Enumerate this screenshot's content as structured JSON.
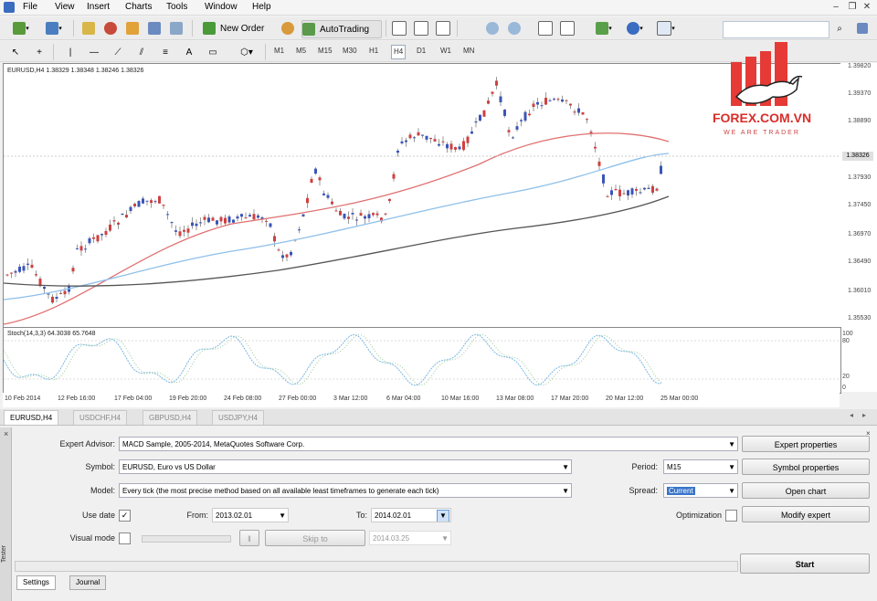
{
  "menu": [
    "File",
    "View",
    "Insert",
    "Charts",
    "Tools",
    "Window",
    "Help"
  ],
  "toolbar": {
    "new_order": "New Order",
    "autotrading": "AutoTrading"
  },
  "timeframes": [
    "M1",
    "M5",
    "M15",
    "M30",
    "H1",
    "H4",
    "D1",
    "W1",
    "MN"
  ],
  "active_timeframe": "H4",
  "chart": {
    "title": "EURUSD,H4  1.38329 1.38348 1.38246 1.38326",
    "price_labels": [
      "1.39820",
      "1.39370",
      "1.38890",
      "1.38326",
      "1.37930",
      "1.37450",
      "1.36970",
      "1.36490",
      "1.36010",
      "1.35530"
    ],
    "current_price": "1.38326",
    "indicator_title": "Stoch(14,3,3) 64.3038 65.7648",
    "indicator_levels": [
      "100",
      "80",
      "20",
      "0"
    ],
    "time_labels": [
      "10 Feb 2014",
      "12 Feb 16:00",
      "17 Feb 04:00",
      "19 Feb 20:00",
      "24 Feb 08:00",
      "27 Feb 00:00",
      "3 Mar 12:00",
      "6 Mar 04:00",
      "10 Mar 16:00",
      "13 Mar 08:00",
      "17 Mar 20:00",
      "20 Mar 12:00",
      "25 Mar 00:00"
    ]
  },
  "chart_tabs": [
    "EURUSD,H4",
    "USDCHF,H4",
    "GBPUSD,H4",
    "USDJPY,H4"
  ],
  "logo": {
    "name": "FOREX.COM.VN",
    "tagline": "WE ARE TRADER"
  },
  "tester": {
    "strip_label": "Tester",
    "expert_advisor_label": "Expert Advisor:",
    "expert_advisor_value": "MACD Sample, 2005-2014, MetaQuotes Software Corp.",
    "symbol_label": "Symbol:",
    "symbol_value": "EURUSD, Euro vs US Dollar",
    "model_label": "Model:",
    "model_value": "Every tick (the most precise method based on all available least timeframes to generate each tick)",
    "use_date_label": "Use date",
    "from_label": "From:",
    "from_value": "2013.02.01",
    "to_label": "To:",
    "to_value": "2014.02.01",
    "visual_mode_label": "Visual mode",
    "skip_to_label": "Skip to",
    "skip_date": "2014.03.25",
    "period_label": "Period:",
    "period_value": "M15",
    "spread_label": "Spread:",
    "spread_value": "Current",
    "optimization_label": "Optimization",
    "expert_properties": "Expert properties",
    "symbol_properties": "Symbol properties",
    "open_chart": "Open chart",
    "modify_expert": "Modify expert",
    "start": "Start",
    "tabs": [
      "Settings",
      "Journal"
    ]
  }
}
